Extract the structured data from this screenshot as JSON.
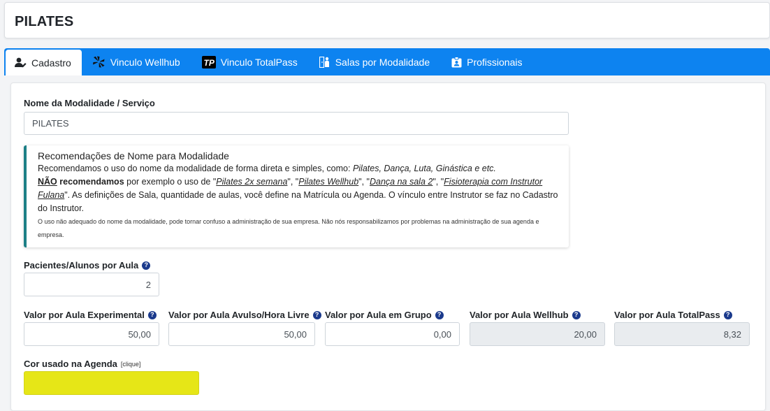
{
  "page": {
    "title": "PILATES"
  },
  "tabs": [
    {
      "label": "Cadastro",
      "icon": "user-edit-icon"
    },
    {
      "label": "Vinculo Wellhub",
      "icon": "wellhub-logo-icon"
    },
    {
      "label": "Vinculo TotalPass",
      "icon": "totalpass-logo-icon"
    },
    {
      "label": "Salas por Modalidade",
      "icon": "room-users-icon"
    },
    {
      "label": "Profissionais",
      "icon": "id-badge-icon"
    }
  ],
  "form": {
    "name_label": "Nome da Modalidade / Serviço",
    "name_value": "PILATES",
    "recommendation": {
      "title": "Recomendações de Nome para Modalidade",
      "line1_prefix": "Recomendamos o uso do nome da modalidade de forma direta e simples, como: ",
      "line1_examples": "Pilates, Dança, Luta, Ginástica e etc.",
      "nao": "NÃO",
      "recomendamos": " recomendamos",
      "line2_prefix": " por exemplo o uso de \"",
      "ex1": "Pilates 2x semana",
      "sep1": "\", \"",
      "ex2": "Pilates Wellhub",
      "sep2": "\", \"",
      "ex3": "Dança na sala 2",
      "sep3": "\", \"",
      "ex4": "Fisioterapia com Instrutor Fulana",
      "line2_suffix": "\". As definições de Sala, quantidade de aulas, você define na Matrícula ou Agenda. O vínculo entre Instrutor se faz no Cadastro do Instrutor.",
      "small_note": "O uso não adequado do nome da modalidade, pode tornar confuso a administração de sua empresa. Não nós responsabilizamos por problemas na administração de sua agenda e empresa."
    },
    "students_label": "Pacientes/Alunos por Aula",
    "students_value": "2",
    "prices": [
      {
        "label": "Valor por Aula Experimental",
        "value": "50,00",
        "disabled": false
      },
      {
        "label": "Valor por Aula Avulso/Hora Livre",
        "value": "50,00",
        "disabled": false
      },
      {
        "label": "Valor por Aula em Grupo",
        "value": "0,00",
        "disabled": false
      },
      {
        "label": "Valor por Aula Wellhub",
        "value": "20,00",
        "disabled": true
      },
      {
        "label": "Valor por Aula TotalPass",
        "value": "8,32",
        "disabled": true
      }
    ],
    "help_glyph": "?",
    "color_label": "Cor usado na Agenda",
    "color_hint": "[clique]",
    "agenda_color": "#e6e617"
  },
  "colors": {
    "tabbar": "#0d83f0",
    "callout_accent": "#1c7f86",
    "help_icon": "#1b3a8c"
  }
}
